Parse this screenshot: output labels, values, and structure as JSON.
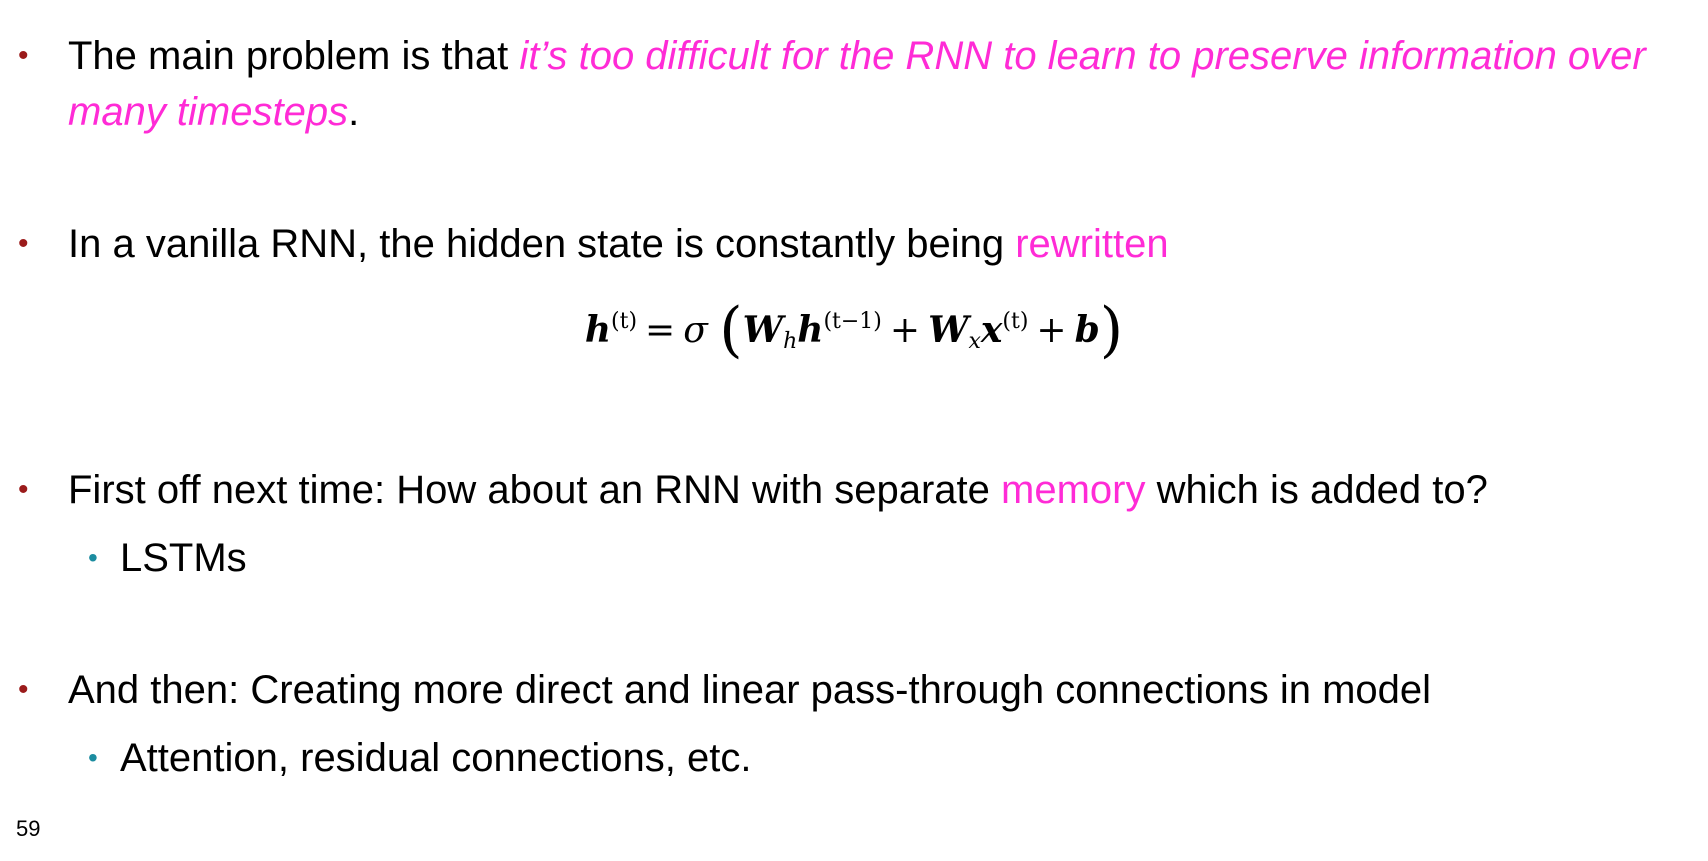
{
  "bullets": [
    {
      "pre": "The main problem is that ",
      "highlight": "it’s too difficult for the RNN to learn to preserve information over many timesteps",
      "post": "."
    },
    {
      "pre": "In a vanilla RNN, the hidden state is constantly being ",
      "highlight": "rewritten",
      "post": ""
    },
    {
      "pre": "First off next time: How about an RNN with separate ",
      "highlight": "memory",
      "post": " which is added to?",
      "sub": "LSTMs"
    },
    {
      "pre": "And then: Creating more direct and linear pass-through connections in model",
      "sub": "Attention, residual connections, etc."
    }
  ],
  "equation": {
    "lhs": "h",
    "lhs_sup": "(t)",
    "equals": "=",
    "sigma": "σ",
    "open_paren": "(",
    "w1": "W",
    "w1_sub": "h",
    "h2": "h",
    "h2_sup": "(t−1)",
    "plus1": "+",
    "w2": "W",
    "w2_sub": "x",
    "x": "x",
    "x_sup": "(t)",
    "plus2": "+",
    "b": "b",
    "close_paren": ")"
  },
  "colors": {
    "highlight": "#ff2bd6",
    "bullet_primary": "#9b1b1b",
    "bullet_secondary": "#1b8ca0"
  },
  "page_number": "59"
}
